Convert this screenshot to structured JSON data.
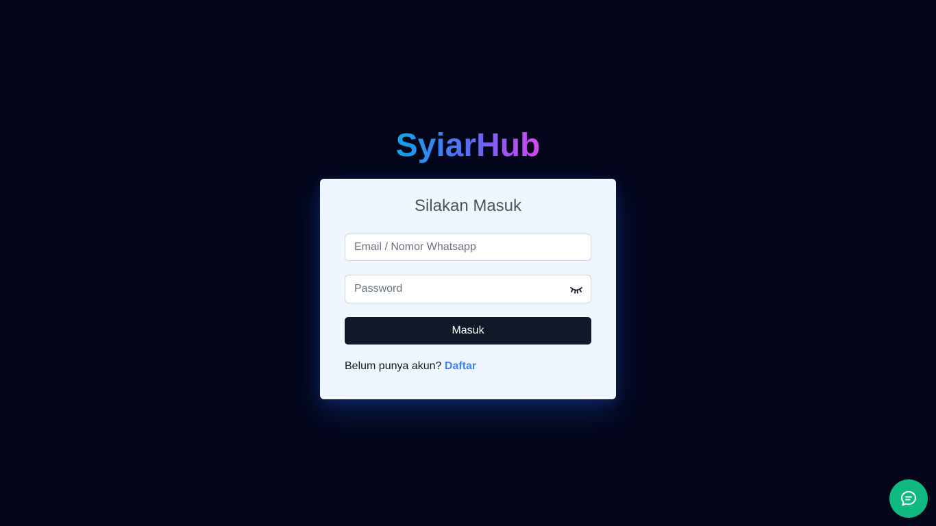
{
  "brand": {
    "name": "SyiarHub"
  },
  "login": {
    "title": "Silakan Masuk",
    "identifier_placeholder": "Email / Nomor Whatsapp",
    "identifier_value": "",
    "password_placeholder": "Password",
    "password_value": "",
    "password_toggle_icon": "eye-closed-icon",
    "submit_label": "Masuk",
    "register_prompt": "Belum punya akun?",
    "register_link": "Daftar"
  },
  "chat_button": {
    "icon": "chat-bubble-icon",
    "color": "#10b981"
  },
  "colors": {
    "background": "#03061a",
    "card": "#eff6ff",
    "button": "#111827",
    "link": "#3b82f6",
    "brand_gradient": [
      "#0ea5e9",
      "#6366f1",
      "#d946ef"
    ]
  }
}
